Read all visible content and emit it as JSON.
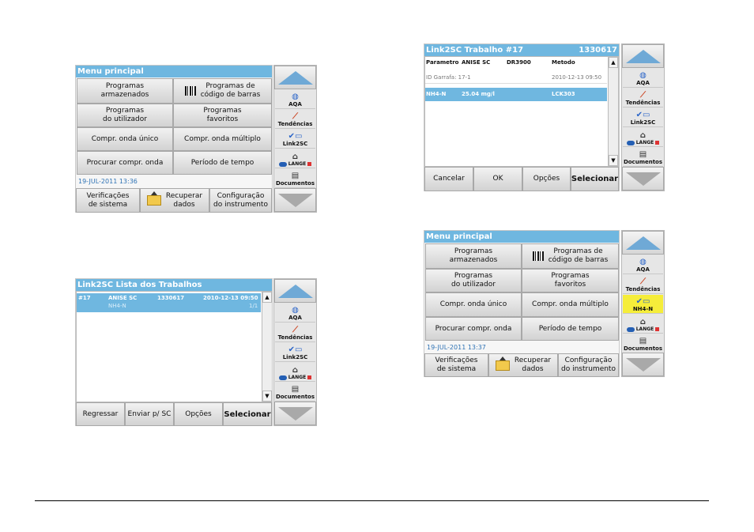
{
  "colors": {
    "title_bar": "#6fb7e0",
    "selected_row": "#6fb7e0",
    "highlight": "#f5ed3a",
    "date_text": "#2f73b5"
  },
  "sidebar_icons": [
    "globe-icon",
    "trend-chart-icon",
    "link2sc-icon",
    "home-icon",
    "documents-icon"
  ],
  "screen1": {
    "title": "Menu principal",
    "buttons": [
      "Programas\narmazenados",
      "Programas de\ncódigo de barras",
      "Programas\ndo utilizador",
      "Programas\nfavoritos",
      "Compr. onda único",
      "Compr. onda múltiplo",
      "Procurar compr. onda",
      "Período de tempo"
    ],
    "datetime": "19-JUL-2011  13:36",
    "bottom": [
      "Verificações\nde sistema",
      "Recuperar\ndados",
      "Configuração\ndo instrumento"
    ],
    "side": [
      "AQA",
      "Tendências",
      "Link2SC",
      "Documentos"
    ]
  },
  "screen2": {
    "title": "Link2SC Lista dos Trabalhos",
    "row": {
      "id": "#17",
      "name": "ANISE SC",
      "number": "1330617",
      "date": "2010-12-13 09:50",
      "param": "NH4-N",
      "page": "1/1"
    },
    "bottom": [
      "Regressar",
      "Enviar p/ SC",
      "Opções",
      "Selecionar"
    ],
    "side": [
      "AQA",
      "Tendências",
      "Link2SC",
      "Documentos"
    ]
  },
  "screen3": {
    "title": "Link2SC Trabalho #17",
    "title_number": "1330617",
    "headers": [
      "Parametro",
      "ANISE SC",
      "DR3900",
      "Metodo"
    ],
    "info": {
      "label": "ID Garrafa: 17-1",
      "date": "2010-12-13 09:50"
    },
    "selected": {
      "param": "NH4-N",
      "value": "25.04 mg/l",
      "method": "LCK303"
    },
    "bottom": [
      "Cancelar",
      "OK",
      "Opções",
      "Selecionar"
    ],
    "side": [
      "AQA",
      "Tendências",
      "Link2SC",
      "Documentos"
    ]
  },
  "screen4": {
    "title": "Menu principal",
    "buttons": [
      "Programas\narmazenados",
      "Programas de\ncódigo de barras",
      "Programas\ndo utilizador",
      "Programas\nfavoritos",
      "Compr. onda único",
      "Compr. onda múltiplo",
      "Procurar compr. onda",
      "Período de tempo"
    ],
    "datetime": "19-JUL-2011  13:37",
    "bottom": [
      "Verificações\nde sistema",
      "Recuperar\ndados",
      "Configuração\ndo instrumento"
    ],
    "side": [
      "AQA",
      "Tendências",
      "NH4-N",
      "Documentos"
    ]
  },
  "lange_text": "LANGE"
}
